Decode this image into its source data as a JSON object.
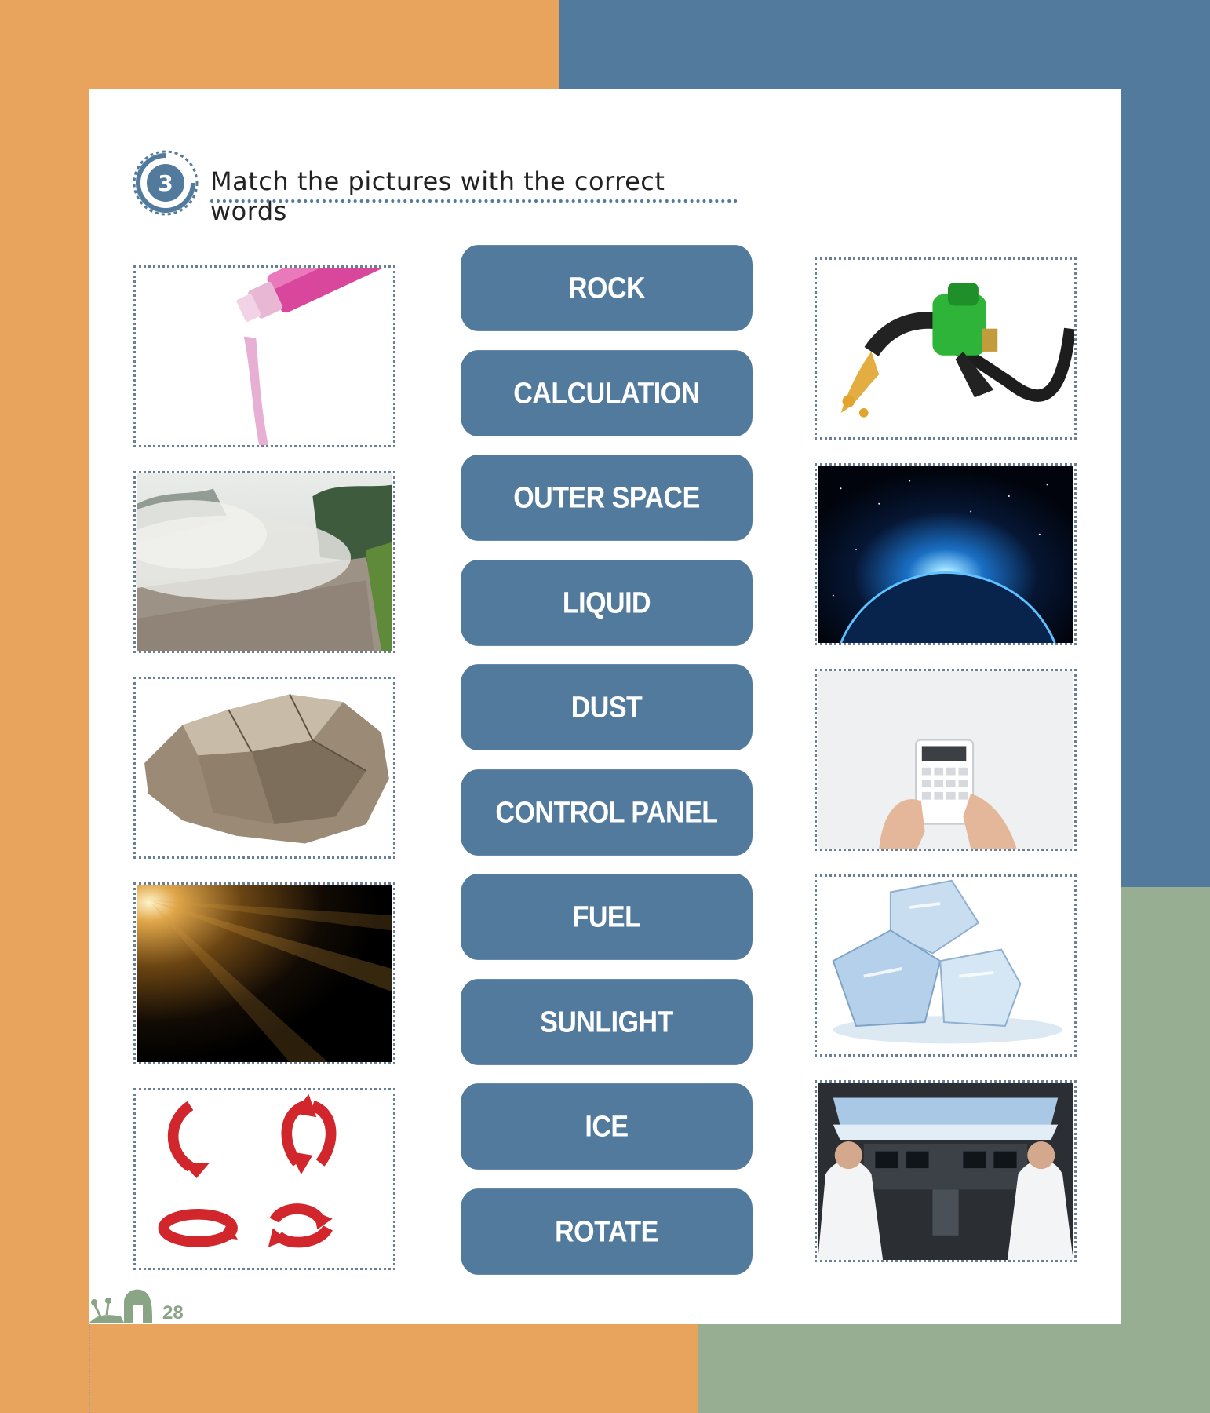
{
  "title": {
    "number": "3",
    "text": "Match the pictures with the correct words"
  },
  "words": [
    "ROCK",
    "CALCULATION",
    "OUTER SPACE",
    "LIQUID",
    "DUST",
    "CONTROL PANEL",
    "FUEL",
    "SUNLIGHT",
    "ICE",
    "ROTATE"
  ],
  "left_pictures": [
    "pouring-liquid-picture",
    "dusty-road-picture",
    "rock-picture",
    "sunlight-picture",
    "rotate-arrows-picture"
  ],
  "right_pictures": [
    "fuel-nozzle-picture",
    "outer-space-picture",
    "calculator-picture",
    "ice-cubes-picture",
    "cockpit-picture"
  ],
  "page_number": "28",
  "colors": {
    "orange": "#E8A35C",
    "blue": "#527A9C",
    "green": "#97AE93",
    "button": "#527A9C"
  }
}
